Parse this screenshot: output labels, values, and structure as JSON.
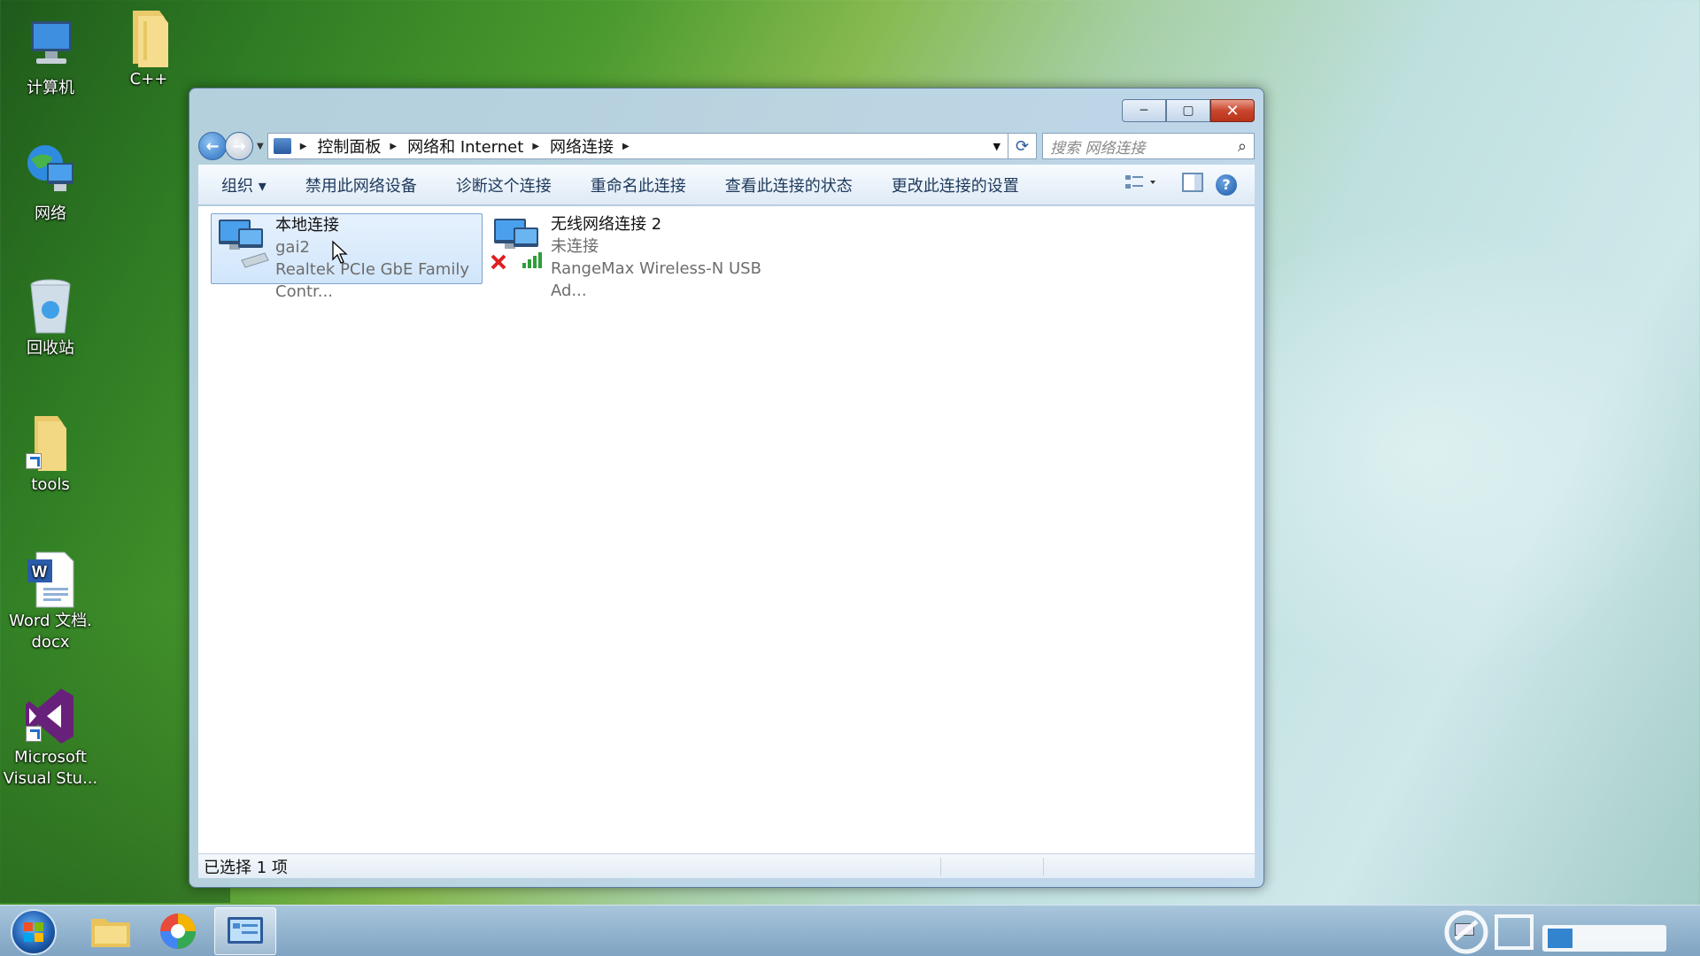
{
  "desktop": {
    "icons": [
      {
        "label_line1": "计算机",
        "label_line2": ""
      },
      {
        "label_line1": "C++",
        "label_line2": ""
      },
      {
        "label_line1": "网络",
        "label_line2": ""
      },
      {
        "label_line1": "回收站",
        "label_line2": ""
      },
      {
        "label_line1": "tools",
        "label_line2": ""
      },
      {
        "label_line1": "Word 文档.",
        "label_line2": "docx"
      },
      {
        "label_line1": "Microsoft",
        "label_line2": "Visual Stu..."
      }
    ]
  },
  "window": {
    "breadcrumb": [
      "控制面板",
      "网络和 Internet",
      "网络连接"
    ],
    "search_placeholder": "搜索 网络连接",
    "toolbar": {
      "organize": "组织 ▾",
      "disable": "禁用此网络设备",
      "diagnose": "诊断这个连接",
      "rename": "重命名此连接",
      "view_status": "查看此连接的状态",
      "change_settings": "更改此连接的设置"
    },
    "connections": [
      {
        "name": "本地连接",
        "status": "gai2",
        "adapter": "Realtek PCIe GbE Family Contr...",
        "selected": true
      },
      {
        "name": "无线网络连接 2",
        "status": "未连接",
        "adapter": "RangeMax Wireless-N USB Ad...",
        "selected": false
      }
    ],
    "statusbar": "已选择 1 项"
  },
  "colors": {
    "accent": "#2a6fc0",
    "close": "#c9472e",
    "selection": "#d1e6fb"
  }
}
